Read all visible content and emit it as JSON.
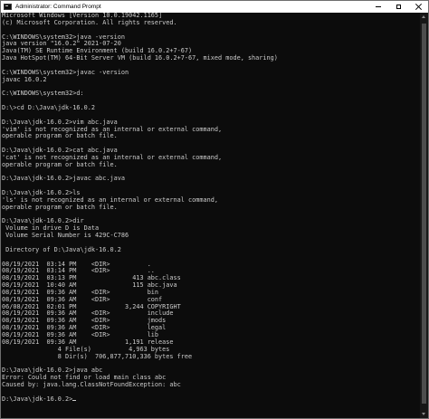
{
  "window": {
    "title": "Administrator: Command Prompt"
  },
  "console": {
    "lines": [
      "Microsoft Windows [Version 10.0.19042.1165]",
      "(c) Microsoft Corporation. All rights reserved.",
      "",
      "C:\\WINDOWS\\system32>java -version",
      "java version \"16.0.2\" 2021-07-20",
      "Java(TM) SE Runtime Environment (build 16.0.2+7-67)",
      "Java HotSpot(TM) 64-Bit Server VM (build 16.0.2+7-67, mixed mode, sharing)",
      "",
      "C:\\WINDOWS\\system32>javac -version",
      "javac 16.0.2",
      "",
      "C:\\WINDOWS\\system32>d:",
      "",
      "D:\\>cd D:\\Java\\jdk-16.0.2",
      "",
      "D:\\Java\\jdk-16.0.2>vim abc.java",
      "'vim' is not recognized as an internal or external command,",
      "operable program or batch file.",
      "",
      "D:\\Java\\jdk-16.0.2>cat abc.java",
      "'cat' is not recognized as an internal or external command,",
      "operable program or batch file.",
      "",
      "D:\\Java\\jdk-16.0.2>javac abc.java",
      "",
      "D:\\Java\\jdk-16.0.2>ls",
      "'ls' is not recognized as an internal or external command,",
      "operable program or batch file.",
      "",
      "D:\\Java\\jdk-16.0.2>dir",
      " Volume in drive D is Data",
      " Volume Serial Number is 429C-C786",
      "",
      " Directory of D:\\Java\\jdk-16.0.2",
      "",
      "08/19/2021  03:14 PM    <DIR>          .",
      "08/19/2021  03:14 PM    <DIR>          ..",
      "08/19/2021  03:13 PM               413 abc.class",
      "08/19/2021  10:40 AM               115 abc.java",
      "08/19/2021  09:36 AM    <DIR>          bin",
      "08/19/2021  09:36 AM    <DIR>          conf",
      "06/08/2021  02:01 PM             3,244 COPYRIGHT",
      "08/19/2021  09:36 AM    <DIR>          include",
      "08/19/2021  09:36 AM    <DIR>          jmods",
      "08/19/2021  09:36 AM    <DIR>          legal",
      "08/19/2021  09:36 AM    <DIR>          lib",
      "08/19/2021  09:36 AM             1,191 release",
      "               4 File(s)          4,963 bytes",
      "               8 Dir(s)  706,877,710,336 bytes free",
      "",
      "D:\\Java\\jdk-16.0.2>java abc",
      "Error: Could not find or load main class abc",
      "Caused by: java.lang.ClassNotFoundException: abc",
      "",
      "D:\\Java\\jdk-16.0.2>"
    ]
  }
}
